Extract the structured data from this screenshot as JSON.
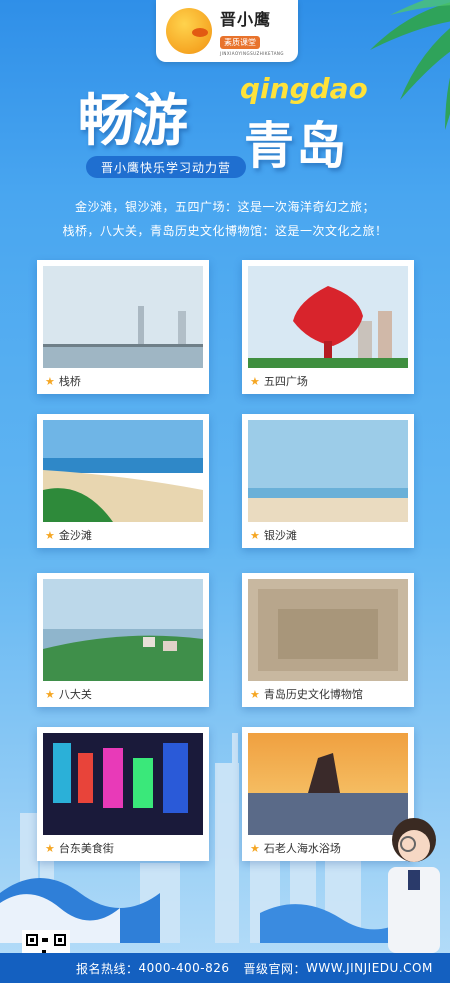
{
  "logo": {
    "name": "晋小鹰",
    "tag": "素质课堂",
    "en": "JINXIAOYINGSUZHIKETANG"
  },
  "title": {
    "cn_main": "畅游",
    "en": "qingdao",
    "cn_city": "青岛",
    "subtitle": "晋小鹰快乐学习动力营"
  },
  "intro": {
    "line1": "金沙滩，银沙滩，五四广场：这是一次海洋奇幻之旅；",
    "line2": "栈桥，八大关，青岛历史文化博物馆：这是一次文化之旅！"
  },
  "spots": [
    {
      "label": "栈桥"
    },
    {
      "label": "五四广场"
    },
    {
      "label": "金沙滩"
    },
    {
      "label": "银沙滩"
    },
    {
      "label": "八大关"
    },
    {
      "label": "青岛历史文化博物馆"
    },
    {
      "label": "台东美食街"
    },
    {
      "label": "石老人海水浴场"
    }
  ],
  "footer": {
    "hotline_label": "报名热线：",
    "hotline": "4000-400-826",
    "site_label": "晋级官网：",
    "site": "WWW.JINJIEDU.COM"
  },
  "colors": {
    "accent": "#1f6fd0",
    "title_en": "#ffe23a",
    "star": "#f5a623"
  }
}
